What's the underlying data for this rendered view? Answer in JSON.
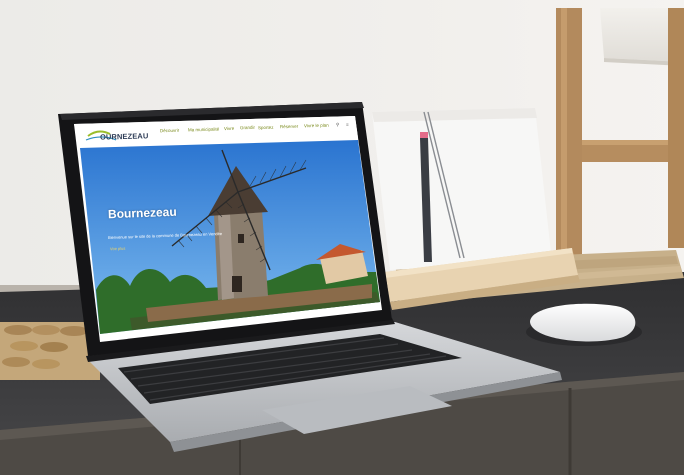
{
  "scene": {
    "objects": [
      "laptop",
      "mouse",
      "notebook",
      "pencil",
      "wooden-stand",
      "bamboo-mat",
      "desk",
      "ladder",
      "lamp"
    ]
  },
  "website": {
    "logo": "OURNEZEAU",
    "nav": [
      "Découvrir",
      "Ma municipalité",
      "Vivre",
      "Grandir",
      "Sportez",
      "Réserver",
      "Vivre le plan"
    ],
    "hero_title": "Bournezeau",
    "hero_subtitle": "Bienvenue sur le site de la commune de Bournezeau en Vendée",
    "hero_button": "Voir plus"
  },
  "colors": {
    "wall": "#efece8",
    "desk": "#3b3b3d",
    "laptop": "#c9cbce",
    "nav_text": "#7a8a1c",
    "sky": "#3a86d8"
  }
}
